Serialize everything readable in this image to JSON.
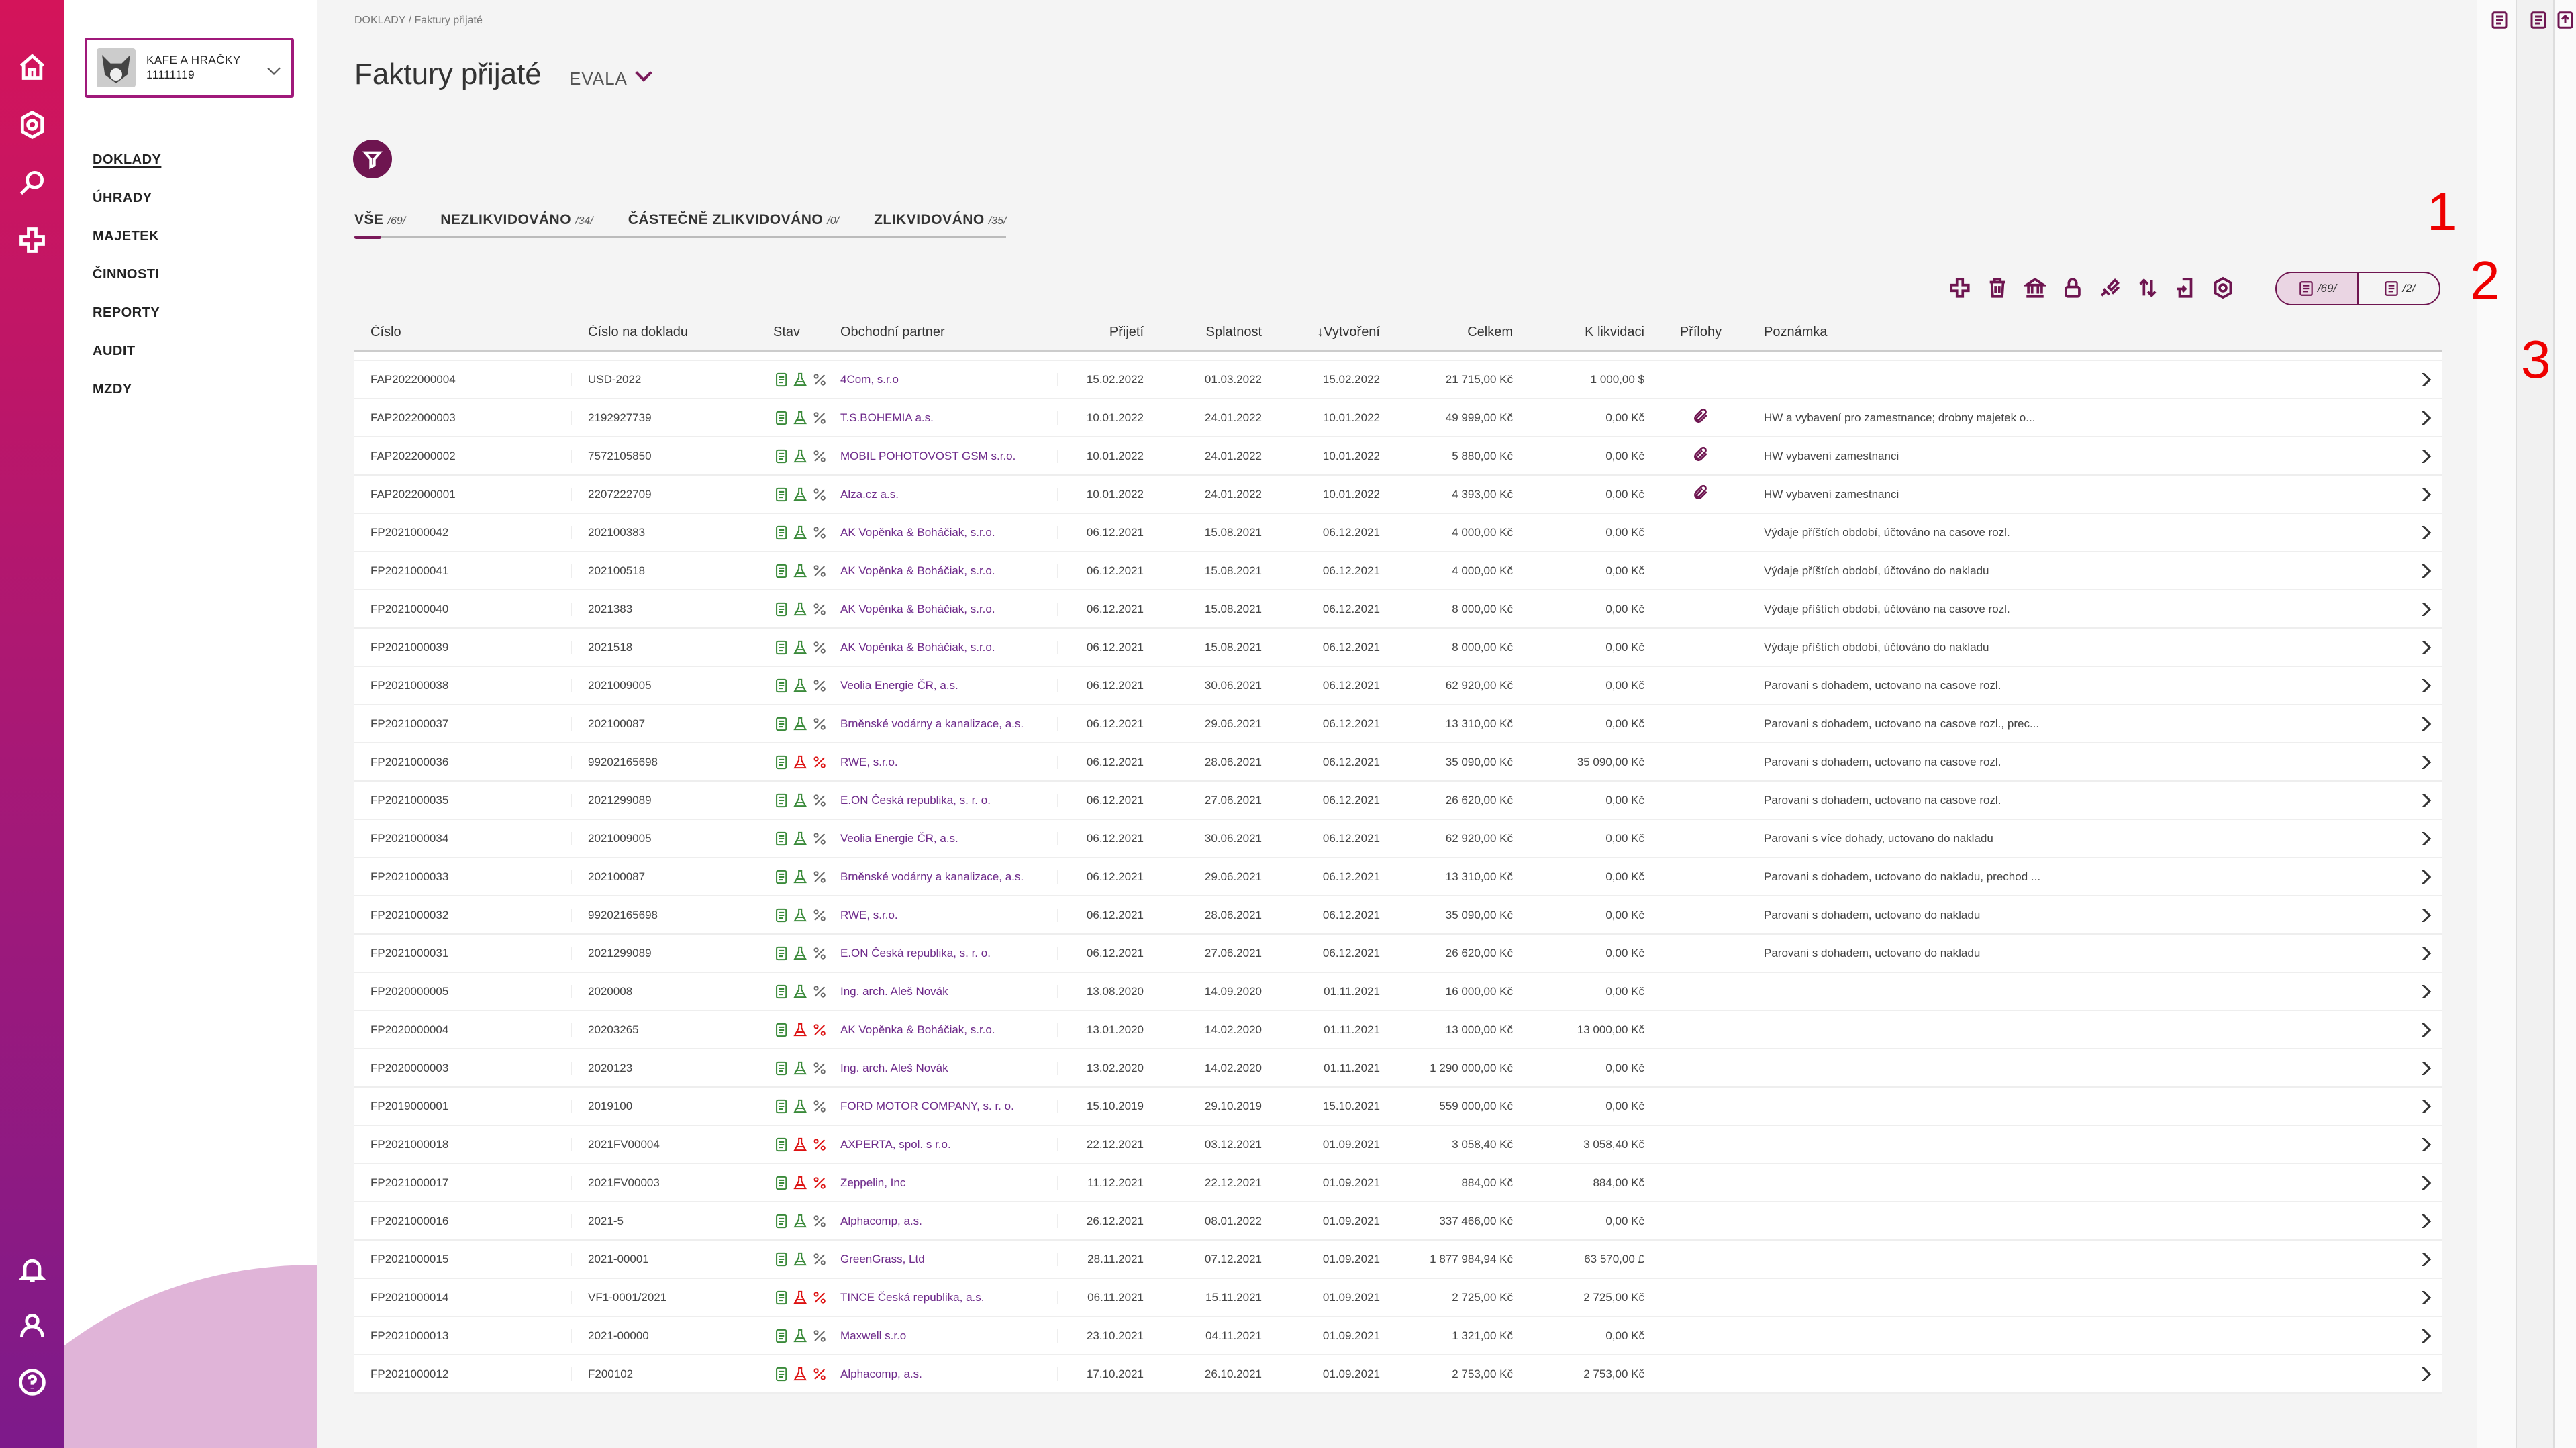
{
  "colors": {
    "accent": "#6e1550",
    "rail_top": "#d4145a",
    "rail_bottom": "#7d1a8a",
    "partner_link": "#6e2a8a"
  },
  "company": {
    "name": "KAFE A HRAČKY",
    "id": "11111119"
  },
  "nav": [
    "DOKLADY",
    "ÚHRADY",
    "MAJETEK",
    "ČINNOSTI",
    "REPORTY",
    "AUDIT",
    "MZDY"
  ],
  "breadcrumb": "DOKLADY  /  Faktury přijaté",
  "page": {
    "title": "Faktury přijaté",
    "subtitle": "EVALA"
  },
  "tabs": [
    {
      "label": "VŠE",
      "count": "/69/"
    },
    {
      "label": "NEZLIKVIDOVÁNO",
      "count": "/34/"
    },
    {
      "label": "ČÁSTEČNĚ ZLIKVIDOVÁNO",
      "count": "/0/"
    },
    {
      "label": "ZLIKVIDOVÁNO",
      "count": "/35/"
    }
  ],
  "segment": {
    "left_count": "/69/",
    "right_count": "/2/"
  },
  "annotations": [
    "1",
    "2",
    "3"
  ],
  "columns": [
    "Číslo",
    "Číslo na dokladu",
    "Stav",
    "Obchodní partner",
    "Přijetí",
    "Splatnost",
    "Vytvoření",
    "Celkem",
    "K likvidaci",
    "Přílohy",
    "Poznámka"
  ],
  "rows": [
    {
      "num": "FAP2022000004",
      "doc": "USD-2022",
      "partner": "4Com, s.r.o",
      "recv": "15.02.2022",
      "due": "01.03.2022",
      "created": "15.02.2022",
      "total": "21 715,00 Kč",
      "liq": "1 000,00 $",
      "att": false,
      "note": "",
      "red": false
    },
    {
      "num": "FAP2022000003",
      "doc": "2192927739",
      "partner": "T.S.BOHEMIA a.s.",
      "recv": "10.01.2022",
      "due": "24.01.2022",
      "created": "10.01.2022",
      "total": "49 999,00 Kč",
      "liq": "0,00 Kč",
      "att": true,
      "note": "HW a vybavení pro zamestnance; drobny majetek o...",
      "red": false
    },
    {
      "num": "FAP2022000002",
      "doc": "7572105850",
      "partner": "MOBIL POHOTOVOST GSM s.r.o.",
      "recv": "10.01.2022",
      "due": "24.01.2022",
      "created": "10.01.2022",
      "total": "5 880,00 Kč",
      "liq": "0,00 Kč",
      "att": true,
      "note": "HW vybavení zamestnanci",
      "red": false
    },
    {
      "num": "FAP2022000001",
      "doc": "2207222709",
      "partner": "Alza.cz a.s.",
      "recv": "10.01.2022",
      "due": "24.01.2022",
      "created": "10.01.2022",
      "total": "4 393,00 Kč",
      "liq": "0,00 Kč",
      "att": true,
      "note": "HW vybavení zamestnanci",
      "red": false
    },
    {
      "num": "FP2021000042",
      "doc": "202100383",
      "partner": "AK Vopěnka & Boháčiak, s.r.o.",
      "recv": "06.12.2021",
      "due": "15.08.2021",
      "created": "06.12.2021",
      "total": "4 000,00 Kč",
      "liq": "0,00 Kč",
      "att": false,
      "note": "Výdaje příštích období, účtováno na casove rozl.",
      "red": false
    },
    {
      "num": "FP2021000041",
      "doc": "202100518",
      "partner": "AK Vopěnka & Boháčiak, s.r.o.",
      "recv": "06.12.2021",
      "due": "15.08.2021",
      "created": "06.12.2021",
      "total": "4 000,00 Kč",
      "liq": "0,00 Kč",
      "att": false,
      "note": "Výdaje příštích období, účtováno do nakladu",
      "red": false
    },
    {
      "num": "FP2021000040",
      "doc": "2021383",
      "partner": "AK Vopěnka & Boháčiak, s.r.o.",
      "recv": "06.12.2021",
      "due": "15.08.2021",
      "created": "06.12.2021",
      "total": "8 000,00 Kč",
      "liq": "0,00 Kč",
      "att": false,
      "note": "Výdaje příštích období, účtováno na casove rozl.",
      "red": false
    },
    {
      "num": "FP2021000039",
      "doc": "2021518",
      "partner": "AK Vopěnka & Boháčiak, s.r.o.",
      "recv": "06.12.2021",
      "due": "15.08.2021",
      "created": "06.12.2021",
      "total": "8 000,00 Kč",
      "liq": "0,00 Kč",
      "att": false,
      "note": "Výdaje příštích období, účtováno do nakladu",
      "red": false
    },
    {
      "num": "FP2021000038",
      "doc": "2021009005",
      "partner": "Veolia Energie ČR, a.s.",
      "recv": "06.12.2021",
      "due": "30.06.2021",
      "created": "06.12.2021",
      "total": "62 920,00 Kč",
      "liq": "0,00 Kč",
      "att": false,
      "note": "Parovani s dohadem, uctovano na casove rozl.",
      "red": false
    },
    {
      "num": "FP2021000037",
      "doc": "202100087",
      "partner": "Brněnské vodárny a kanalizace, a.s.",
      "recv": "06.12.2021",
      "due": "29.06.2021",
      "created": "06.12.2021",
      "total": "13 310,00 Kč",
      "liq": "0,00 Kč",
      "att": false,
      "note": "Parovani s dohadem, uctovano na casove rozl., prec...",
      "red": false
    },
    {
      "num": "FP2021000036",
      "doc": "99202165698",
      "partner": "RWE, s.r.o.",
      "recv": "06.12.2021",
      "due": "28.06.2021",
      "created": "06.12.2021",
      "total": "35 090,00 Kč",
      "liq": "35 090,00 Kč",
      "att": false,
      "note": "Parovani s dohadem, uctovano na casove rozl.",
      "red": true
    },
    {
      "num": "FP2021000035",
      "doc": "2021299089",
      "partner": "E.ON Česká republika, s. r. o.",
      "recv": "06.12.2021",
      "due": "27.06.2021",
      "created": "06.12.2021",
      "total": "26 620,00 Kč",
      "liq": "0,00 Kč",
      "att": false,
      "note": "Parovani s dohadem, uctovano na casove rozl.",
      "red": false
    },
    {
      "num": "FP2021000034",
      "doc": "2021009005",
      "partner": "Veolia Energie ČR, a.s.",
      "recv": "06.12.2021",
      "due": "30.06.2021",
      "created": "06.12.2021",
      "total": "62 920,00 Kč",
      "liq": "0,00 Kč",
      "att": false,
      "note": "Parovani s více dohady, uctovano do nakladu",
      "red": false
    },
    {
      "num": "FP2021000033",
      "doc": "202100087",
      "partner": "Brněnské vodárny a kanalizace, a.s.",
      "recv": "06.12.2021",
      "due": "29.06.2021",
      "created": "06.12.2021",
      "total": "13 310,00 Kč",
      "liq": "0,00 Kč",
      "att": false,
      "note": "Parovani s dohadem, uctovano do nakladu, prechod ...",
      "red": false
    },
    {
      "num": "FP2021000032",
      "doc": "99202165698",
      "partner": "RWE, s.r.o.",
      "recv": "06.12.2021",
      "due": "28.06.2021",
      "created": "06.12.2021",
      "total": "35 090,00 Kč",
      "liq": "0,00 Kč",
      "att": false,
      "note": "Parovani s dohadem, uctovano do nakladu",
      "red": false
    },
    {
      "num": "FP2021000031",
      "doc": "2021299089",
      "partner": "E.ON Česká republika, s. r. o.",
      "recv": "06.12.2021",
      "due": "27.06.2021",
      "created": "06.12.2021",
      "total": "26 620,00 Kč",
      "liq": "0,00 Kč",
      "att": false,
      "note": "Parovani s dohadem, uctovano do nakladu",
      "red": false
    },
    {
      "num": "FP2020000005",
      "doc": "2020008",
      "partner": "Ing. arch. Aleš Novák",
      "recv": "13.08.2020",
      "due": "14.09.2020",
      "created": "01.11.2021",
      "total": "16 000,00 Kč",
      "liq": "0,00 Kč",
      "att": false,
      "note": "",
      "red": false
    },
    {
      "num": "FP2020000004",
      "doc": "20203265",
      "partner": "AK Vopěnka & Boháčiak, s.r.o.",
      "recv": "13.01.2020",
      "due": "14.02.2020",
      "created": "01.11.2021",
      "total": "13 000,00 Kč",
      "liq": "13 000,00 Kč",
      "att": false,
      "note": "",
      "red": true
    },
    {
      "num": "FP2020000003",
      "doc": "2020123",
      "partner": "Ing. arch. Aleš Novák",
      "recv": "13.02.2020",
      "due": "14.02.2020",
      "created": "01.11.2021",
      "total": "1 290 000,00 Kč",
      "liq": "0,00 Kč",
      "att": false,
      "note": "",
      "red": false
    },
    {
      "num": "FP2019000001",
      "doc": "2019100",
      "partner": "FORD MOTOR COMPANY, s. r. o.",
      "recv": "15.10.2019",
      "due": "29.10.2019",
      "created": "15.10.2021",
      "total": "559 000,00 Kč",
      "liq": "0,00 Kč",
      "att": false,
      "note": "",
      "red": false
    },
    {
      "num": "FP2021000018",
      "doc": "2021FV00004",
      "partner": "AXPERTA, spol. s r.o.",
      "recv": "22.12.2021",
      "due": "03.12.2021",
      "created": "01.09.2021",
      "total": "3 058,40 Kč",
      "liq": "3 058,40 Kč",
      "att": false,
      "note": "",
      "red": true
    },
    {
      "num": "FP2021000017",
      "doc": "2021FV00003",
      "partner": "Zeppelin, Inc",
      "recv": "11.12.2021",
      "due": "22.12.2021",
      "created": "01.09.2021",
      "total": "884,00 Kč",
      "liq": "884,00 Kč",
      "att": false,
      "note": "",
      "red": true
    },
    {
      "num": "FP2021000016",
      "doc": "2021-5",
      "partner": "Alphacomp, a.s.",
      "recv": "26.12.2021",
      "due": "08.01.2022",
      "created": "01.09.2021",
      "total": "337 466,00 Kč",
      "liq": "0,00 Kč",
      "att": false,
      "note": "",
      "red": false
    },
    {
      "num": "FP2021000015",
      "doc": "2021-00001",
      "partner": "GreenGrass, Ltd",
      "recv": "28.11.2021",
      "due": "07.12.2021",
      "created": "01.09.2021",
      "total": "1 877 984,94 Kč",
      "liq": "63 570,00 £",
      "att": false,
      "note": "",
      "red": false
    },
    {
      "num": "FP2021000014",
      "doc": "VF1-0001/2021",
      "partner": "TINCE Česká republika, a.s.",
      "recv": "06.11.2021",
      "due": "15.11.2021",
      "created": "01.09.2021",
      "total": "2 725,00 Kč",
      "liq": "2 725,00 Kč",
      "att": false,
      "note": "",
      "red": true
    },
    {
      "num": "FP2021000013",
      "doc": "2021-00000",
      "partner": "Maxwell s.r.o",
      "recv": "23.10.2021",
      "due": "04.11.2021",
      "created": "01.09.2021",
      "total": "1 321,00 Kč",
      "liq": "0,00 Kč",
      "att": false,
      "note": "",
      "red": false
    },
    {
      "num": "FP2021000012",
      "doc": "F200102",
      "partner": "Alphacomp, a.s.",
      "recv": "17.10.2021",
      "due": "26.10.2021",
      "created": "01.09.2021",
      "total": "2 753,00 Kč",
      "liq": "2 753,00 Kč",
      "att": false,
      "note": "",
      "red": true
    }
  ]
}
